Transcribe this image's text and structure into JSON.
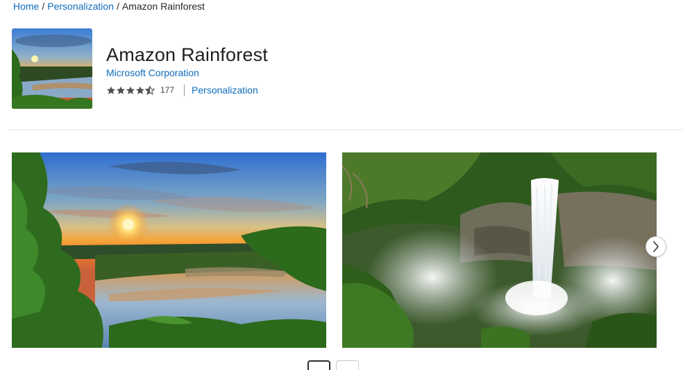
{
  "breadcrumb": {
    "home": "Home",
    "section": "Personalization",
    "current": "Amazon Rainforest",
    "separator": "/"
  },
  "app": {
    "title": "Amazon Rainforest",
    "publisher": "Microsoft Corporation",
    "rating": 4.5,
    "rating_count": "177",
    "category": "Personalization"
  },
  "screenshots": [
    {
      "name": "sunset-river",
      "description_icon": "image"
    },
    {
      "name": "waterfall",
      "description_icon": "image"
    }
  ],
  "carousel": {
    "pages": 2,
    "active_index": 0
  },
  "colors": {
    "link": "#0f6cbd",
    "star": "#505050"
  }
}
